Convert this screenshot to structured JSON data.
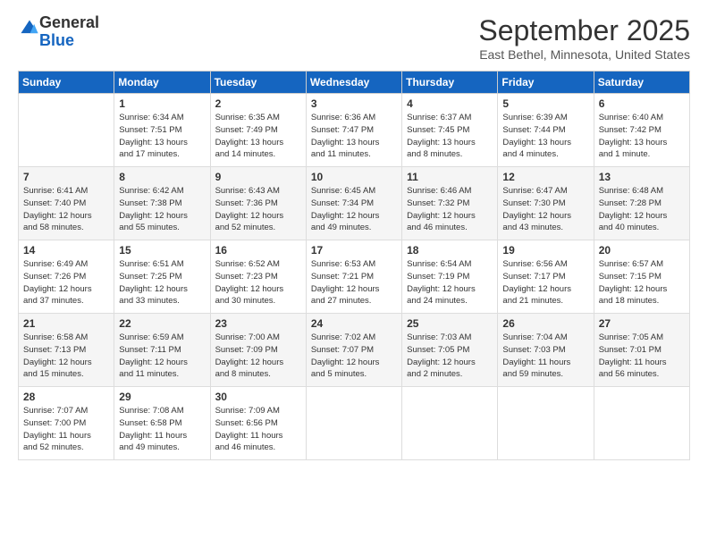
{
  "header": {
    "logo": {
      "general": "General",
      "blue": "Blue"
    },
    "title": "September 2025",
    "subtitle": "East Bethel, Minnesota, United States"
  },
  "calendar": {
    "days_of_week": [
      "Sunday",
      "Monday",
      "Tuesday",
      "Wednesday",
      "Thursday",
      "Friday",
      "Saturday"
    ],
    "weeks": [
      [
        {
          "day": "",
          "detail": ""
        },
        {
          "day": "1",
          "detail": "Sunrise: 6:34 AM\nSunset: 7:51 PM\nDaylight: 13 hours\nand 17 minutes."
        },
        {
          "day": "2",
          "detail": "Sunrise: 6:35 AM\nSunset: 7:49 PM\nDaylight: 13 hours\nand 14 minutes."
        },
        {
          "day": "3",
          "detail": "Sunrise: 6:36 AM\nSunset: 7:47 PM\nDaylight: 13 hours\nand 11 minutes."
        },
        {
          "day": "4",
          "detail": "Sunrise: 6:37 AM\nSunset: 7:45 PM\nDaylight: 13 hours\nand 8 minutes."
        },
        {
          "day": "5",
          "detail": "Sunrise: 6:39 AM\nSunset: 7:44 PM\nDaylight: 13 hours\nand 4 minutes."
        },
        {
          "day": "6",
          "detail": "Sunrise: 6:40 AM\nSunset: 7:42 PM\nDaylight: 13 hours\nand 1 minute."
        }
      ],
      [
        {
          "day": "7",
          "detail": "Sunrise: 6:41 AM\nSunset: 7:40 PM\nDaylight: 12 hours\nand 58 minutes."
        },
        {
          "day": "8",
          "detail": "Sunrise: 6:42 AM\nSunset: 7:38 PM\nDaylight: 12 hours\nand 55 minutes."
        },
        {
          "day": "9",
          "detail": "Sunrise: 6:43 AM\nSunset: 7:36 PM\nDaylight: 12 hours\nand 52 minutes."
        },
        {
          "day": "10",
          "detail": "Sunrise: 6:45 AM\nSunset: 7:34 PM\nDaylight: 12 hours\nand 49 minutes."
        },
        {
          "day": "11",
          "detail": "Sunrise: 6:46 AM\nSunset: 7:32 PM\nDaylight: 12 hours\nand 46 minutes."
        },
        {
          "day": "12",
          "detail": "Sunrise: 6:47 AM\nSunset: 7:30 PM\nDaylight: 12 hours\nand 43 minutes."
        },
        {
          "day": "13",
          "detail": "Sunrise: 6:48 AM\nSunset: 7:28 PM\nDaylight: 12 hours\nand 40 minutes."
        }
      ],
      [
        {
          "day": "14",
          "detail": "Sunrise: 6:49 AM\nSunset: 7:26 PM\nDaylight: 12 hours\nand 37 minutes."
        },
        {
          "day": "15",
          "detail": "Sunrise: 6:51 AM\nSunset: 7:25 PM\nDaylight: 12 hours\nand 33 minutes."
        },
        {
          "day": "16",
          "detail": "Sunrise: 6:52 AM\nSunset: 7:23 PM\nDaylight: 12 hours\nand 30 minutes."
        },
        {
          "day": "17",
          "detail": "Sunrise: 6:53 AM\nSunset: 7:21 PM\nDaylight: 12 hours\nand 27 minutes."
        },
        {
          "day": "18",
          "detail": "Sunrise: 6:54 AM\nSunset: 7:19 PM\nDaylight: 12 hours\nand 24 minutes."
        },
        {
          "day": "19",
          "detail": "Sunrise: 6:56 AM\nSunset: 7:17 PM\nDaylight: 12 hours\nand 21 minutes."
        },
        {
          "day": "20",
          "detail": "Sunrise: 6:57 AM\nSunset: 7:15 PM\nDaylight: 12 hours\nand 18 minutes."
        }
      ],
      [
        {
          "day": "21",
          "detail": "Sunrise: 6:58 AM\nSunset: 7:13 PM\nDaylight: 12 hours\nand 15 minutes."
        },
        {
          "day": "22",
          "detail": "Sunrise: 6:59 AM\nSunset: 7:11 PM\nDaylight: 12 hours\nand 11 minutes."
        },
        {
          "day": "23",
          "detail": "Sunrise: 7:00 AM\nSunset: 7:09 PM\nDaylight: 12 hours\nand 8 minutes."
        },
        {
          "day": "24",
          "detail": "Sunrise: 7:02 AM\nSunset: 7:07 PM\nDaylight: 12 hours\nand 5 minutes."
        },
        {
          "day": "25",
          "detail": "Sunrise: 7:03 AM\nSunset: 7:05 PM\nDaylight: 12 hours\nand 2 minutes."
        },
        {
          "day": "26",
          "detail": "Sunrise: 7:04 AM\nSunset: 7:03 PM\nDaylight: 11 hours\nand 59 minutes."
        },
        {
          "day": "27",
          "detail": "Sunrise: 7:05 AM\nSunset: 7:01 PM\nDaylight: 11 hours\nand 56 minutes."
        }
      ],
      [
        {
          "day": "28",
          "detail": "Sunrise: 7:07 AM\nSunset: 7:00 PM\nDaylight: 11 hours\nand 52 minutes."
        },
        {
          "day": "29",
          "detail": "Sunrise: 7:08 AM\nSunset: 6:58 PM\nDaylight: 11 hours\nand 49 minutes."
        },
        {
          "day": "30",
          "detail": "Sunrise: 7:09 AM\nSunset: 6:56 PM\nDaylight: 11 hours\nand 46 minutes."
        },
        {
          "day": "",
          "detail": ""
        },
        {
          "day": "",
          "detail": ""
        },
        {
          "day": "",
          "detail": ""
        },
        {
          "day": "",
          "detail": ""
        }
      ]
    ]
  }
}
